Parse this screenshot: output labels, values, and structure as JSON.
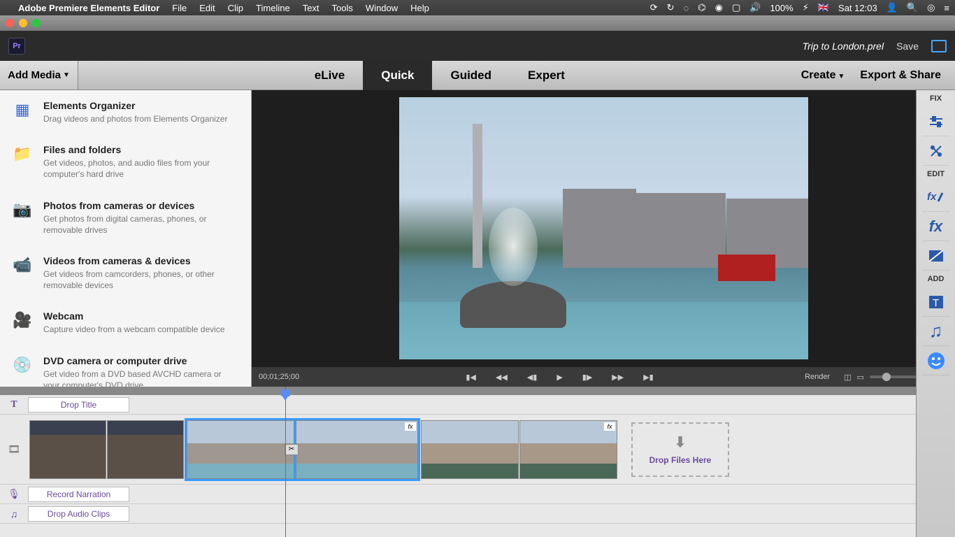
{
  "menubar": {
    "app_name": "Adobe Premiere Elements Editor",
    "items": [
      "File",
      "Edit",
      "Clip",
      "Timeline",
      "Text",
      "Tools",
      "Window",
      "Help"
    ],
    "status": {
      "battery": "100%",
      "flag": "🇬🇧",
      "time": "Sat 12:03"
    }
  },
  "topbar": {
    "filename": "Trip to London.prel",
    "save": "Save"
  },
  "modebar": {
    "add_media": "Add Media",
    "tabs": [
      "eLive",
      "Quick",
      "Guided",
      "Expert"
    ],
    "active_tab": "Quick",
    "create": "Create",
    "export": "Export & Share"
  },
  "add_media_menu": [
    {
      "title": "Elements Organizer",
      "desc": "Drag videos and photos from Elements Organizer",
      "icon": "▦"
    },
    {
      "title": "Files and folders",
      "desc": "Get videos, photos, and audio files from your computer's hard drive",
      "icon": "📁"
    },
    {
      "title": "Photos from cameras or devices",
      "desc": "Get photos from digital cameras, phones, or removable drives",
      "icon": "📷"
    },
    {
      "title": "Videos from cameras & devices",
      "desc": "Get videos from camcorders, phones, or other removable devices",
      "icon": "📹"
    },
    {
      "title": "Webcam",
      "desc": "Capture video from a webcam compatible device",
      "icon": "🎥"
    },
    {
      "title": "DVD camera or computer drive",
      "desc": "Get video from a DVD based AVCHD camera or your computer's DVD drive",
      "icon": "💿"
    }
  ],
  "controls": {
    "timecode": "00;01;25;00",
    "render": "Render"
  },
  "timeline": {
    "drop_title": "Drop Title",
    "drop_files": "Drop Files Here",
    "record_narration": "Record Narration",
    "drop_audio": "Drop Audio Clips"
  },
  "sidebar": {
    "fix": "FIX",
    "edit": "EDIT",
    "add": "ADD"
  }
}
